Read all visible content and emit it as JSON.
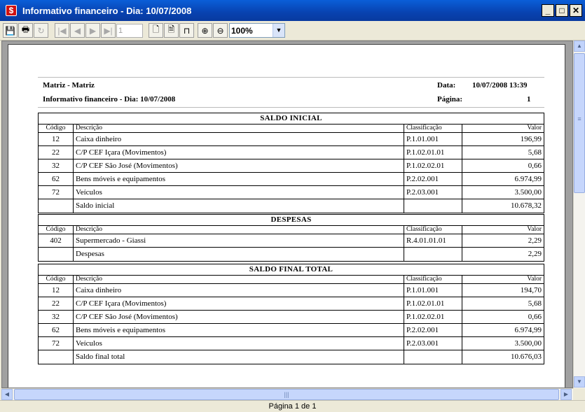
{
  "window": {
    "title": "Informativo financeiro - Dia: 10/07/2008",
    "app_icon": "$",
    "minimize_glyph": "_",
    "maximize_glyph": "□",
    "close_glyph": "✕"
  },
  "toolbar": {
    "save_icon": "💾",
    "print_icon": "🖶",
    "refresh_icon": "↻",
    "first_icon": "|◀",
    "prev_icon": "◀",
    "next_icon": "▶",
    "last_icon": "▶|",
    "page_value": "1",
    "single_page_icon": "🗋",
    "two_page_icon": "🗎",
    "page_width_icon": "⊓",
    "zoom_in_icon": "⊕",
    "zoom_out_icon": "⊖",
    "zoom_value": "100%",
    "dropdown_icon": "▼"
  },
  "report": {
    "company": "Matriz - Matriz",
    "subtitle": "Informativo financeiro - Dia: 10/07/2008",
    "date_label": "Data:",
    "date_value": "10/07/2008 13:39",
    "page_label": "Página:",
    "page_value": "1",
    "columns": {
      "codigo": "Código",
      "descricao": "Descrição",
      "classificacao": "Classificação",
      "valor": "Valor"
    },
    "sections": [
      {
        "title": "SALDO INICIAL",
        "rows": [
          {
            "codigo": "12",
            "descricao": "Caixa dinheiro",
            "classificacao": "P.1.01.001",
            "valor": "196,99"
          },
          {
            "codigo": "22",
            "descricao": "C/P CEF Içara (Movimentos)",
            "classificacao": "P.1.02.01.01",
            "valor": "5,68"
          },
          {
            "codigo": "32",
            "descricao": "C/P CEF São José (Movimentos)",
            "classificacao": "P.1.02.02.01",
            "valor": "0,66"
          },
          {
            "codigo": "62",
            "descricao": "Bens móveis e equipamentos",
            "classificacao": "P.2.02.001",
            "valor": "6.974,99"
          },
          {
            "codigo": "72",
            "descricao": "Veículos",
            "classificacao": "P.2.03.001",
            "valor": "3.500,00"
          }
        ],
        "total_label": "Saldo inicial",
        "total_value": "10.678,32"
      },
      {
        "title": "DESPESAS",
        "rows": [
          {
            "codigo": "402",
            "descricao": "Supermercado - Giassi",
            "classificacao": "R.4.01.01.01",
            "valor": "2,29"
          }
        ],
        "total_label": "Despesas",
        "total_value": "2,29"
      },
      {
        "title": "SALDO FINAL TOTAL",
        "rows": [
          {
            "codigo": "12",
            "descricao": "Caixa dinheiro",
            "classificacao": "P.1.01.001",
            "valor": "194,70"
          },
          {
            "codigo": "22",
            "descricao": "C/P CEF Içara (Movimentos)",
            "classificacao": "P.1.02.01.01",
            "valor": "5,68"
          },
          {
            "codigo": "32",
            "descricao": "C/P CEF São José (Movimentos)",
            "classificacao": "P.1.02.02.01",
            "valor": "0,66"
          },
          {
            "codigo": "62",
            "descricao": "Bens móveis e equipamentos",
            "classificacao": "P.2.02.001",
            "valor": "6.974,99"
          },
          {
            "codigo": "72",
            "descricao": "Veículos",
            "classificacao": "P.2.03.001",
            "valor": "3.500,00"
          }
        ],
        "total_label": "Saldo final total",
        "total_value": "10.676,03"
      }
    ]
  },
  "scrollbars": {
    "up_icon": "▲",
    "down_icon": "▼",
    "left_icon": "◀",
    "right_icon": "▶",
    "grip_v": "≡",
    "grip_h": "|||"
  },
  "status": {
    "page_info": "Página 1 de 1"
  }
}
